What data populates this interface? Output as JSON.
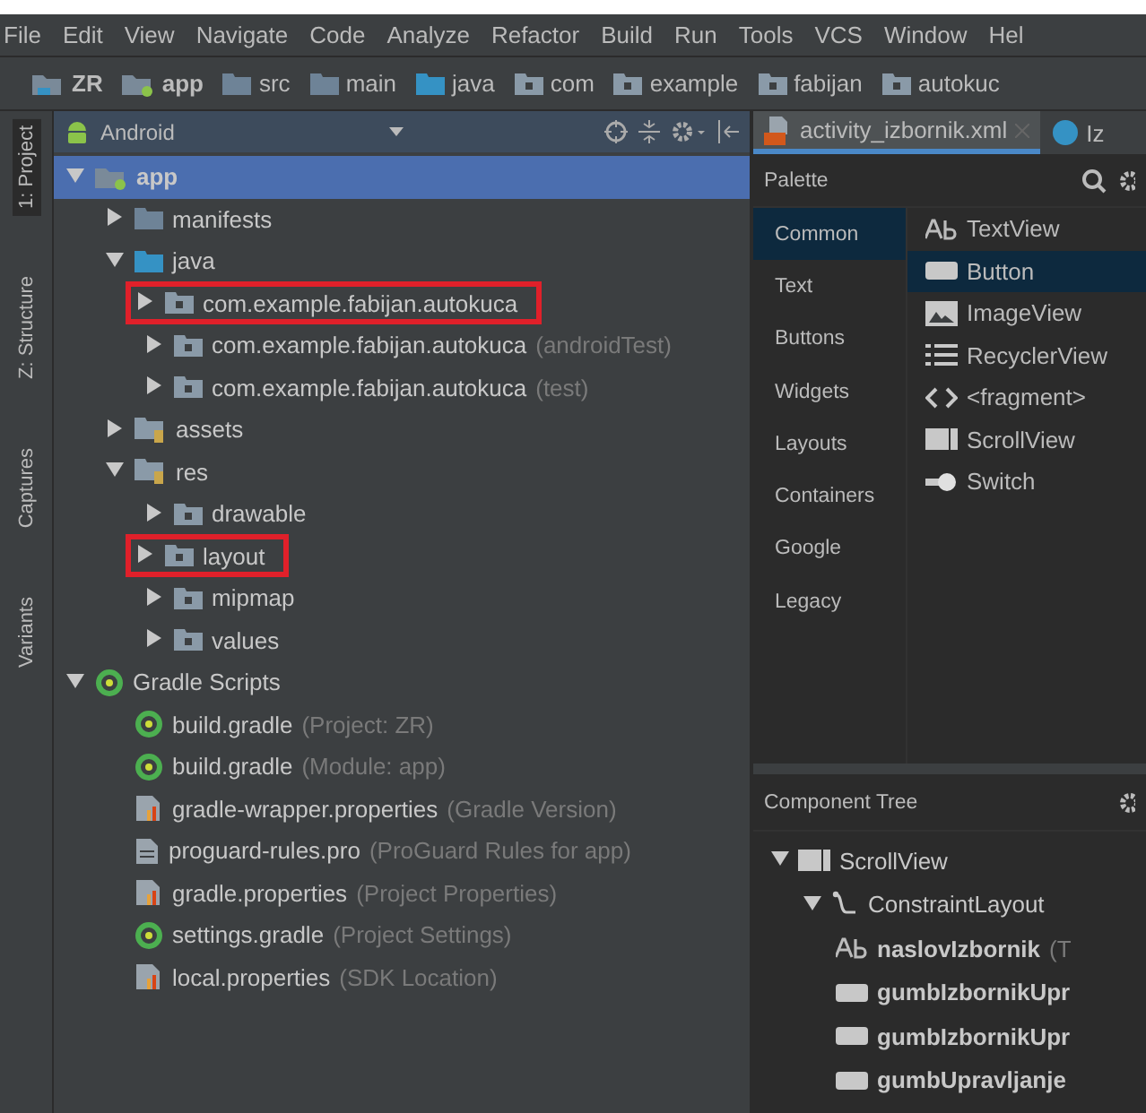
{
  "menu": [
    "File",
    "Edit",
    "View",
    "Navigate",
    "Code",
    "Analyze",
    "Refactor",
    "Build",
    "Run",
    "Tools",
    "VCS",
    "Window",
    "Hel"
  ],
  "breadcrumbs": [
    {
      "label": "ZR",
      "kind": "project"
    },
    {
      "label": "app",
      "kind": "module"
    },
    {
      "label": "src",
      "kind": "folder"
    },
    {
      "label": "main",
      "kind": "folder"
    },
    {
      "label": "java",
      "kind": "source"
    },
    {
      "label": "com",
      "kind": "package"
    },
    {
      "label": "example",
      "kind": "package"
    },
    {
      "label": "fabijan",
      "kind": "package"
    },
    {
      "label": "autokuc",
      "kind": "package"
    }
  ],
  "side_tabs": [
    {
      "label": "1: Project",
      "selected": true
    },
    {
      "label": "Z: Structure",
      "selected": false
    },
    {
      "label": "Captures",
      "selected": false
    },
    {
      "label": "Variants",
      "selected": false
    }
  ],
  "project": {
    "view": "Android",
    "tree": [
      {
        "label": "app",
        "kind": "module",
        "expanded": true,
        "selected": true,
        "outlined": false,
        "children": [
          {
            "label": "manifests",
            "kind": "folder",
            "expanded": false,
            "selected": false,
            "outlined": false
          },
          {
            "label": "java",
            "kind": "source",
            "expanded": true,
            "selected": false,
            "outlined": false,
            "children": [
              {
                "label": "com.example.fabijan.autokuca",
                "kind": "package",
                "expanded": false,
                "selected": false,
                "outlined": true
              },
              {
                "label": "com.example.fabijan.autokuca",
                "detail": "(androidTest)",
                "kind": "package",
                "expanded": false,
                "selected": false,
                "outlined": false
              },
              {
                "label": "com.example.fabijan.autokuca",
                "detail": "(test)",
                "kind": "package",
                "expanded": false,
                "selected": false,
                "outlined": false
              }
            ]
          },
          {
            "label": "assets",
            "kind": "resfolder",
            "expanded": false,
            "selected": false,
            "outlined": false
          },
          {
            "label": "res",
            "kind": "resfolder",
            "expanded": true,
            "selected": false,
            "outlined": false,
            "children": [
              {
                "label": "drawable",
                "kind": "package",
                "expanded": false,
                "selected": false,
                "outlined": false
              },
              {
                "label": "layout",
                "kind": "package",
                "expanded": false,
                "selected": false,
                "outlined": true
              },
              {
                "label": "mipmap",
                "kind": "package",
                "expanded": false,
                "selected": false,
                "outlined": false
              },
              {
                "label": "values",
                "kind": "package",
                "expanded": false,
                "selected": false,
                "outlined": false
              }
            ]
          }
        ]
      },
      {
        "label": "Gradle Scripts",
        "kind": "gradle",
        "expanded": true,
        "selected": false,
        "outlined": false,
        "children": [
          {
            "label": "build.gradle",
            "detail": "(Project: ZR)",
            "kind": "gradle",
            "selected": false,
            "outlined": false
          },
          {
            "label": "build.gradle",
            "detail": "(Module: app)",
            "kind": "gradle",
            "selected": false,
            "outlined": false
          },
          {
            "label": "gradle-wrapper.properties",
            "detail": "(Gradle Version)",
            "kind": "properties",
            "selected": false,
            "outlined": false
          },
          {
            "label": "proguard-rules.pro",
            "detail": "(ProGuard Rules for app)",
            "kind": "file",
            "selected": false,
            "outlined": false
          },
          {
            "label": "gradle.properties",
            "detail": "(Project Properties)",
            "kind": "properties",
            "selected": false,
            "outlined": false
          },
          {
            "label": "settings.gradle",
            "detail": "(Project Settings)",
            "kind": "gradle",
            "selected": false,
            "outlined": false
          },
          {
            "label": "local.properties",
            "detail": "(SDK Location)",
            "kind": "properties",
            "selected": false,
            "outlined": false
          }
        ]
      }
    ]
  },
  "editor_tabs": [
    {
      "label": "activity_izbornik.xml",
      "kind": "xml",
      "selected": true
    },
    {
      "label": "Iz",
      "kind": "class",
      "selected": false
    }
  ],
  "palette": {
    "title": "Palette",
    "categories": [
      {
        "label": "Common",
        "selected": true
      },
      {
        "label": "Text",
        "selected": false
      },
      {
        "label": "Buttons",
        "selected": false
      },
      {
        "label": "Widgets",
        "selected": false
      },
      {
        "label": "Layouts",
        "selected": false
      },
      {
        "label": "Containers",
        "selected": false
      },
      {
        "label": "Google",
        "selected": false
      },
      {
        "label": "Legacy",
        "selected": false
      }
    ],
    "items": [
      {
        "label": "TextView",
        "kind": "text",
        "selected": false
      },
      {
        "label": "Button",
        "kind": "button",
        "selected": true
      },
      {
        "label": "ImageView",
        "kind": "image",
        "selected": false
      },
      {
        "label": "RecyclerView",
        "kind": "list",
        "selected": false
      },
      {
        "label": "<fragment>",
        "kind": "code",
        "selected": false
      },
      {
        "label": "ScrollView",
        "kind": "scroll",
        "selected": false
      },
      {
        "label": "Switch",
        "kind": "switch",
        "selected": false
      }
    ]
  },
  "component_tree": {
    "title": "Component Tree",
    "tree": [
      {
        "label": "ScrollView",
        "kind": "scroll",
        "expanded": true,
        "children": [
          {
            "label": "ConstraintLayout",
            "kind": "constraint",
            "expanded": true,
            "children": [
              {
                "label": "naslovIzbornik",
                "detail": "(T",
                "kind": "text"
              },
              {
                "label": "gumbIzbornikUpr",
                "kind": "button"
              },
              {
                "label": "gumbIzbornikUpr",
                "kind": "button"
              },
              {
                "label": "gumbUpravljanje",
                "kind": "button"
              }
            ]
          }
        ]
      }
    ]
  }
}
